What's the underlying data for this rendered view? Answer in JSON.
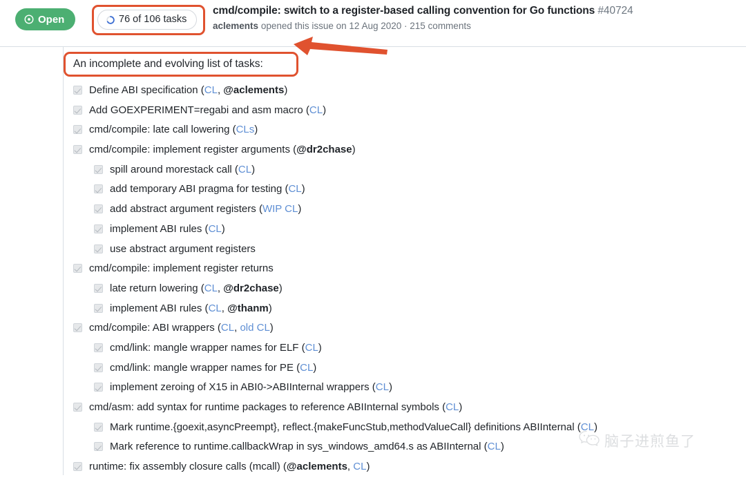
{
  "header": {
    "state_badge": {
      "label": "Open",
      "icon": "issue-open-icon",
      "color": "#4caf72"
    },
    "tasks_pill": {
      "label": "76 of 106 tasks",
      "icon": "progress-circle-icon",
      "completed": 76,
      "total": 106
    },
    "title": "cmd/compile: switch to a register-based calling convention for Go functions",
    "issue_number": "#40724",
    "meta": {
      "author": "aclements",
      "action": "opened this issue on",
      "date": "12 Aug 2020",
      "separator": "·",
      "comments": "215 comments"
    }
  },
  "body": {
    "intro": "An incomplete and evolving list of tasks:",
    "tasks": [
      {
        "level": 0,
        "checked": true,
        "parts": [
          {
            "t": "Define ABI specification ("
          },
          {
            "t": "CL",
            "k": "link"
          },
          {
            "t": ", "
          },
          {
            "t": "@aclements",
            "k": "mention"
          },
          {
            "t": ")"
          }
        ]
      },
      {
        "level": 0,
        "checked": true,
        "parts": [
          {
            "t": "Add GOEXPERIMENT=regabi and asm macro ("
          },
          {
            "t": "CL",
            "k": "link"
          },
          {
            "t": ")"
          }
        ]
      },
      {
        "level": 0,
        "checked": true,
        "parts": [
          {
            "t": "cmd/compile: late call lowering ("
          },
          {
            "t": "CLs",
            "k": "link"
          },
          {
            "t": ")"
          }
        ]
      },
      {
        "level": 0,
        "checked": true,
        "parts": [
          {
            "t": "cmd/compile: implement register arguments ("
          },
          {
            "t": "@dr2chase",
            "k": "mention"
          },
          {
            "t": ")"
          }
        ]
      },
      {
        "level": 1,
        "checked": true,
        "parts": [
          {
            "t": "spill around morestack call ("
          },
          {
            "t": "CL",
            "k": "link"
          },
          {
            "t": ")"
          }
        ]
      },
      {
        "level": 1,
        "checked": true,
        "parts": [
          {
            "t": "add temporary ABI pragma for testing ("
          },
          {
            "t": "CL",
            "k": "link"
          },
          {
            "t": ")"
          }
        ]
      },
      {
        "level": 1,
        "checked": true,
        "parts": [
          {
            "t": "add abstract argument registers ("
          },
          {
            "t": "WIP CL",
            "k": "link"
          },
          {
            "t": ")"
          }
        ]
      },
      {
        "level": 1,
        "checked": true,
        "parts": [
          {
            "t": "implement ABI rules ("
          },
          {
            "t": "CL",
            "k": "link"
          },
          {
            "t": ")"
          }
        ]
      },
      {
        "level": 1,
        "checked": true,
        "parts": [
          {
            "t": "use abstract argument registers"
          }
        ]
      },
      {
        "level": 0,
        "checked": true,
        "parts": [
          {
            "t": "cmd/compile: implement register returns"
          }
        ]
      },
      {
        "level": 1,
        "checked": true,
        "parts": [
          {
            "t": "late return lowering ("
          },
          {
            "t": "CL",
            "k": "link"
          },
          {
            "t": ", "
          },
          {
            "t": "@dr2chase",
            "k": "mention"
          },
          {
            "t": ")"
          }
        ]
      },
      {
        "level": 1,
        "checked": true,
        "parts": [
          {
            "t": "implement ABI rules ("
          },
          {
            "t": "CL",
            "k": "link"
          },
          {
            "t": ", "
          },
          {
            "t": "@thanm",
            "k": "mention"
          },
          {
            "t": ")"
          }
        ]
      },
      {
        "level": 0,
        "checked": true,
        "parts": [
          {
            "t": "cmd/compile: ABI wrappers ("
          },
          {
            "t": "CL",
            "k": "link"
          },
          {
            "t": ", "
          },
          {
            "t": "old CL",
            "k": "link"
          },
          {
            "t": ")"
          }
        ]
      },
      {
        "level": 1,
        "checked": true,
        "parts": [
          {
            "t": "cmd/link: mangle wrapper names for ELF ("
          },
          {
            "t": "CL",
            "k": "link"
          },
          {
            "t": ")"
          }
        ]
      },
      {
        "level": 1,
        "checked": true,
        "parts": [
          {
            "t": "cmd/link: mangle wrapper names for PE ("
          },
          {
            "t": "CL",
            "k": "link"
          },
          {
            "t": ")"
          }
        ]
      },
      {
        "level": 1,
        "checked": true,
        "parts": [
          {
            "t": "implement zeroing of X15 in ABI0->ABIInternal wrappers ("
          },
          {
            "t": "CL",
            "k": "link"
          },
          {
            "t": ")"
          }
        ]
      },
      {
        "level": 0,
        "checked": true,
        "parts": [
          {
            "t": "cmd/asm: add syntax for runtime packages to reference ABIInternal symbols ("
          },
          {
            "t": "CL",
            "k": "link"
          },
          {
            "t": ")"
          }
        ]
      },
      {
        "level": 1,
        "checked": true,
        "parts": [
          {
            "t": "Mark runtime.{goexit,asyncPreempt}, reflect.{makeFuncStub,methodValueCall} definitions ABIInternal ("
          },
          {
            "t": "CL",
            "k": "link"
          },
          {
            "t": ")"
          }
        ]
      },
      {
        "level": 1,
        "checked": true,
        "parts": [
          {
            "t": "Mark reference to runtime.callbackWrap in sys_windows_amd64.s as ABIInternal ("
          },
          {
            "t": "CL",
            "k": "link"
          },
          {
            "t": ")"
          }
        ]
      },
      {
        "level": 0,
        "checked": true,
        "parts": [
          {
            "t": "runtime: fix assembly closure calls (mcall) ("
          },
          {
            "t": "@aclements",
            "k": "mention"
          },
          {
            "t": ", "
          },
          {
            "t": "CL",
            "k": "link"
          },
          {
            "t": ")"
          }
        ]
      }
    ]
  },
  "annotations": {
    "color": "#e0522f",
    "highlight_tasks_pill": true,
    "highlight_intro": true,
    "arrow_points_to": "tasks_pill"
  },
  "watermark": {
    "text": "脑子进煎鱼了",
    "icon": "wechat-icon"
  }
}
